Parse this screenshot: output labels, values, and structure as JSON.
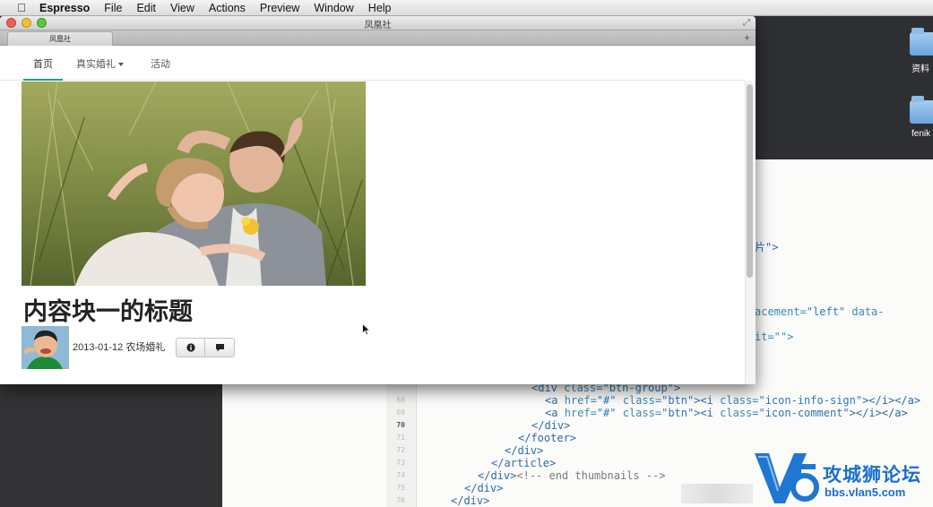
{
  "menubar": {
    "app": "Espresso",
    "items": [
      "File",
      "Edit",
      "View",
      "Actions",
      "Preview",
      "Window",
      "Help"
    ]
  },
  "desktop": {
    "icons": [
      {
        "label": "资料",
        "icon": "folder-icon"
      },
      {
        "label": "fenik",
        "icon": "folder-icon"
      }
    ]
  },
  "browser": {
    "window_title": "凤凰社",
    "tab_label": "凤凰社",
    "nav": {
      "items": [
        {
          "label": "首页",
          "active": true
        },
        {
          "label": "真实婚礼",
          "dropdown": true
        },
        {
          "label": "活动"
        }
      ]
    },
    "post": {
      "title": "内容块一的标题",
      "date": "2013-01-12",
      "category": "农场婚礼",
      "buttons": [
        {
          "icon": "info-sign-icon"
        },
        {
          "icon": "comment-icon"
        }
      ]
    },
    "scroll": {
      "position_fraction": 0.0
    }
  },
  "editor": {
    "line_numbers": [
      "68",
      "69",
      "70",
      "71",
      "72",
      "73",
      "74",
      "75",
      "76"
    ],
    "active_line": "70",
    "partial_lines": [
      {
        "text": "片\">"
      },
      {
        "p1": "acement=",
        "p2": "\"left\"",
        "p3": " data-"
      },
      {
        "text": "it=\"\">"
      }
    ]
  },
  "watermark": {
    "mark": "V5",
    "title": "攻城狮论坛",
    "url": "bbs.vlan5.com"
  },
  "colors": {
    "accent": "#1e9d8b",
    "code_tag": "#2e6aa8",
    "watermark": "#1b6fd0"
  }
}
